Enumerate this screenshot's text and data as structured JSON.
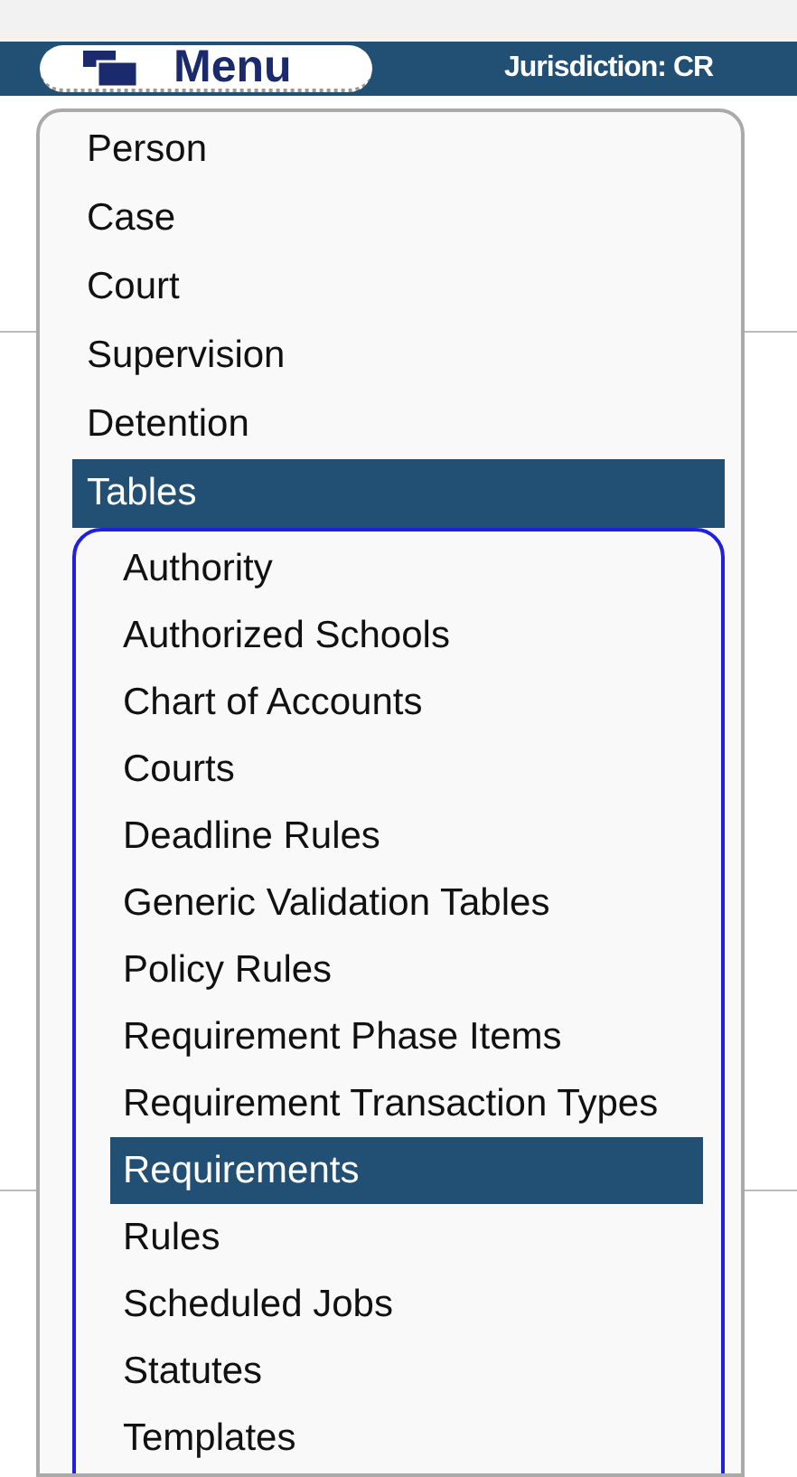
{
  "header": {
    "menu_button": "Menu",
    "jurisdiction": "Jurisdiction: CR"
  },
  "menu": {
    "items": [
      {
        "label": "Person",
        "selected": false
      },
      {
        "label": "Case",
        "selected": false
      },
      {
        "label": "Court",
        "selected": false
      },
      {
        "label": "Supervision",
        "selected": false
      },
      {
        "label": "Detention",
        "selected": false
      },
      {
        "label": "Tables",
        "selected": true,
        "expanded": true,
        "children": [
          {
            "label": "Authority",
            "selected": false
          },
          {
            "label": "Authorized Schools",
            "selected": false
          },
          {
            "label": "Chart of Accounts",
            "selected": false
          },
          {
            "label": "Courts",
            "selected": false
          },
          {
            "label": "Deadline Rules",
            "selected": false
          },
          {
            "label": "Generic Validation Tables",
            "selected": false
          },
          {
            "label": "Policy Rules",
            "selected": false
          },
          {
            "label": "Requirement Phase Items",
            "selected": false
          },
          {
            "label": "Requirement Transaction Types",
            "selected": false
          },
          {
            "label": "Requirements",
            "selected": true
          },
          {
            "label": "Rules",
            "selected": false
          },
          {
            "label": "Scheduled Jobs",
            "selected": false
          },
          {
            "label": "Statutes",
            "selected": false
          },
          {
            "label": "Templates",
            "selected": false
          }
        ]
      }
    ]
  }
}
